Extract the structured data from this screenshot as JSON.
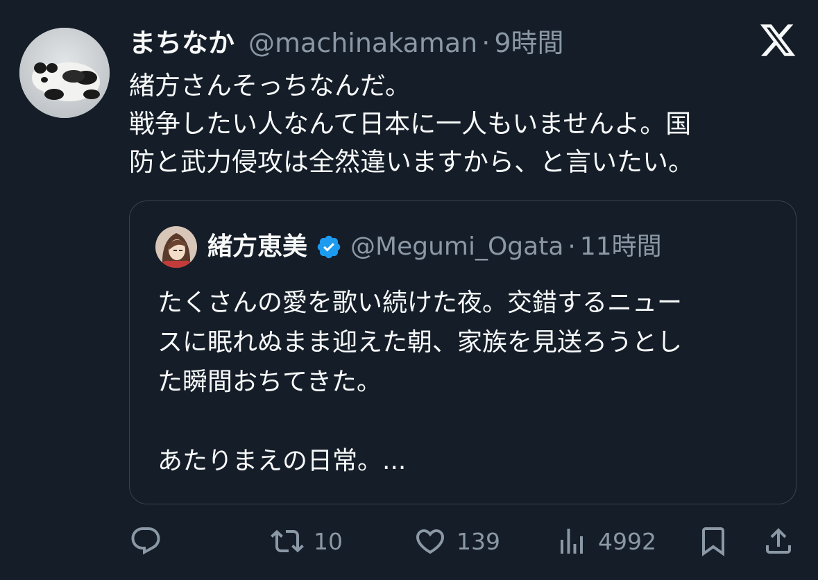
{
  "post": {
    "display_name": "まちなか",
    "handle": "@machinakaman",
    "separator": "·",
    "time": "9時間",
    "lines": [
      "緒方さんそっちなんだ。",
      "戦争したい人なんて日本に一人もいませんよ。国",
      "防と武力侵攻は全然違いますから、と言いたい。"
    ],
    "avatar_icon": "panda-avatar",
    "logo_icon": "x-logo-icon"
  },
  "quote": {
    "display_name": "緒方恵美",
    "verified": true,
    "handle": "@Megumi_Ogata",
    "separator": "·",
    "time": "11時間",
    "lines": [
      "たくさんの愛を歌い続けた夜。交錯するニュー",
      "スに眠れぬまま迎えた朝、家族を見送ろうとし",
      "た瞬間おちてきた。",
      "",
      "あたりまえの日常。..."
    ]
  },
  "actions": {
    "reply_icon": "reply-icon",
    "retweet_count": "10",
    "like_count": "139",
    "view_count": "4992",
    "bookmark_icon": "bookmark-icon",
    "share_icon": "share-icon"
  },
  "colors": {
    "background": "#151d28",
    "text": "#f7f9f9",
    "muted": "#8b98a5",
    "border": "#38444d",
    "verified": "#1d9bf0"
  }
}
